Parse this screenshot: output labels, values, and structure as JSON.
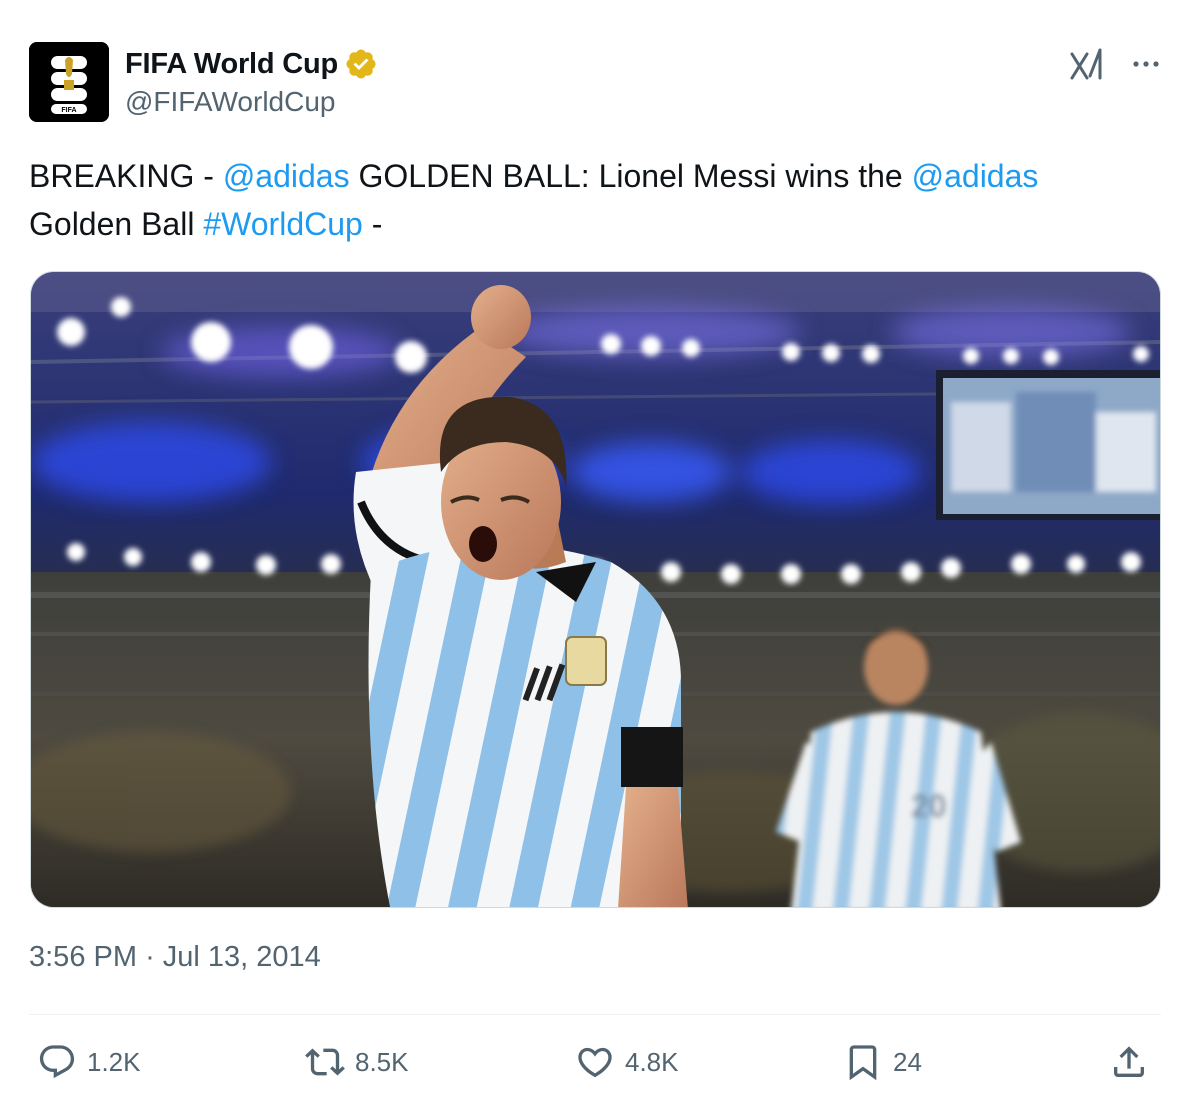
{
  "account": {
    "display_name": "FIFA World Cup",
    "handle": "@FIFAWorldCup",
    "avatar_text": "FIFA",
    "verified_icon": "verified-badge-icon",
    "verified_color": "#e2b719"
  },
  "tweet": {
    "text_parts": {
      "p1": "BREAKING - ",
      "m1": "@adidas",
      "p2": " GOLDEN BALL: Lionel Messi wins the ",
      "m2": "@adidas",
      "p3": " Golden Ball ",
      "h1": "#WorldCup",
      "p4": " -"
    },
    "link_color": "#1d9bf0",
    "time": "3:56 PM",
    "separator": "·",
    "date": "Jul 13, 2014"
  },
  "actions": {
    "reply_count": "1.2K",
    "retweet_count": "8.5K",
    "like_count": "4.8K",
    "bookmark_count": "24"
  },
  "icons": {
    "grok": "grok-icon",
    "more": "more-icon",
    "reply": "reply-icon",
    "retweet": "retweet-icon",
    "like": "like-icon",
    "bookmark": "bookmark-icon",
    "share": "share-icon"
  }
}
